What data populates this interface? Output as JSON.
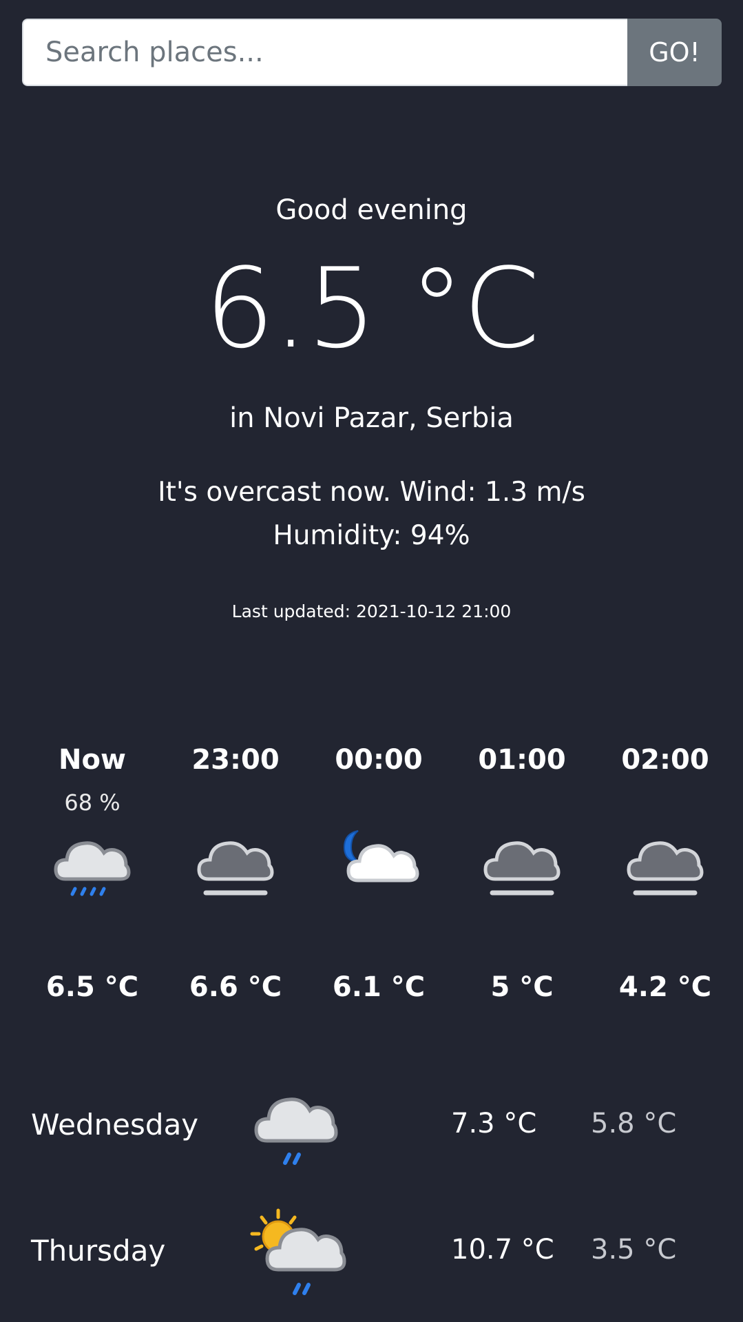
{
  "search": {
    "placeholder": "Search places...",
    "button_label": "GO!"
  },
  "current": {
    "greeting": "Good evening",
    "temperature": "6.5 °C",
    "location": "in Novi Pazar, Serbia",
    "description": "It's overcast now. Wind: 1.3 m/s",
    "humidity": "Humidity: 94%",
    "last_updated": "Last updated: 2021-10-12 21:00"
  },
  "hourly": [
    {
      "time": "Now",
      "pop": "68 %",
      "icon": "cloud-rain-icon",
      "temp": "6.5 °C"
    },
    {
      "time": "23:00",
      "pop": "",
      "icon": "overcast-fog-icon",
      "temp": "6.6 °C"
    },
    {
      "time": "00:00",
      "pop": "",
      "icon": "cloud-moon-icon",
      "temp": "6.1 °C"
    },
    {
      "time": "01:00",
      "pop": "",
      "icon": "overcast-fog-icon",
      "temp": "5 °C"
    },
    {
      "time": "02:00",
      "pop": "",
      "icon": "overcast-fog-icon",
      "temp": "4.2 °C"
    }
  ],
  "daily": [
    {
      "day": "Wednesday",
      "icon": "cloud-rain-icon",
      "max": "7.3 °C",
      "min": "5.8 °C"
    },
    {
      "day": "Thursday",
      "icon": "sun-cloud-rain-icon",
      "max": "10.7 °C",
      "min": "3.5 °C"
    }
  ],
  "colors": {
    "background": "#222531",
    "button": "#6c757d",
    "rain": "#2f80ed",
    "moon": "#1e6fd9",
    "sun": "#f5b820",
    "cloud_light": "#e2e4e7",
    "cloud_dark": "#6a6d75"
  }
}
